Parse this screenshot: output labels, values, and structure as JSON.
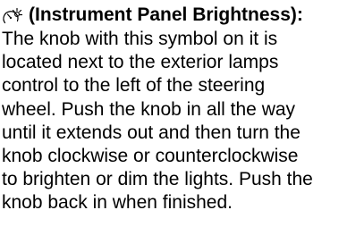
{
  "entry": {
    "icon": "instrument-panel-brightness-icon",
    "heading": "(Instrument Panel Brightness):",
    "body_lines": [
      "The knob with this symbol on it is",
      "located next to the exterior lamps",
      "control to the left of the steering",
      "wheel. Push the knob in all the way",
      "until it extends out and then turn the",
      "knob clockwise or counterclockwise",
      "to brighten or dim the lights. Push the",
      "knob back in when finished."
    ]
  }
}
